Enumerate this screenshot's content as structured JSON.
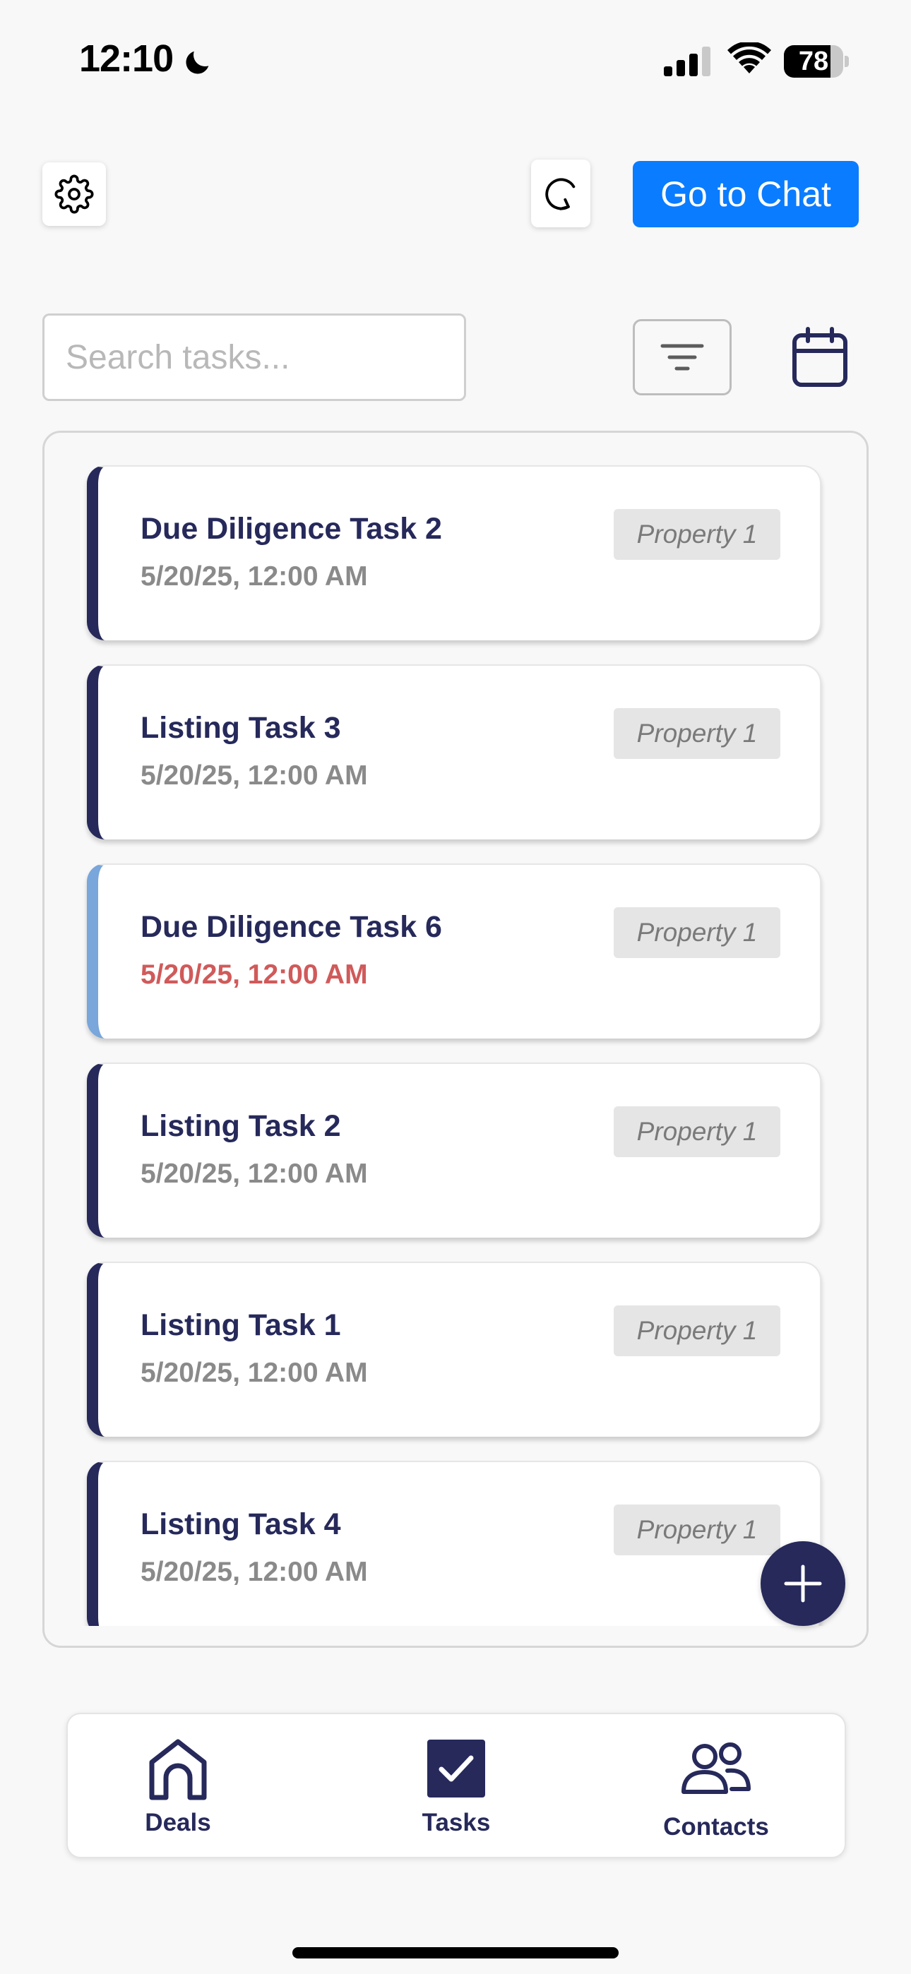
{
  "status_bar": {
    "time": "12:10",
    "battery": "78",
    "battery_level": 0.78,
    "icons": [
      "moon-icon",
      "signal-icon",
      "wifi-icon",
      "battery-icon"
    ]
  },
  "toolbar": {
    "settings_icon": "gear-icon",
    "refresh_icon": "refresh-icon",
    "chat_label": "Go to Chat"
  },
  "search": {
    "value": "",
    "placeholder": "Search tasks...",
    "filter_icon": "filter-icon",
    "calendar_icon": "calendar-icon"
  },
  "tasks": [
    {
      "title": "Due Diligence Task 2",
      "date": "5/20/25, 12:00 AM",
      "tag": "Property 1"
    },
    {
      "title": "Listing Task 3",
      "date": "5/20/25, 12:00 AM",
      "tag": "Property 1"
    },
    {
      "title": "Due Diligence Task 6",
      "date": "5/20/25, 12:00 AM",
      "tag": "Property 1"
    },
    {
      "title": "Listing Task 2",
      "date": "5/20/25, 12:00 AM",
      "tag": "Property 1"
    },
    {
      "title": "Listing Task 1",
      "date": "5/20/25, 12:00 AM",
      "tag": "Property 1"
    },
    {
      "title": "Listing Task 4",
      "date": "5/20/25, 12:00 AM",
      "tag": "Property 1"
    }
  ],
  "fab": {
    "icon": "plus-icon"
  },
  "nav": {
    "deals": {
      "label": "Deals",
      "icon": "home-icon"
    },
    "tasks": {
      "label": "Tasks",
      "icon": "checkbox-icon"
    },
    "contacts": {
      "label": "Contacts",
      "icon": "users-icon"
    }
  },
  "colors": {
    "primary": "#26295a",
    "accent_blue": "#0a7cff",
    "accent_light": "#79a6db",
    "overdue": "#d05a5a",
    "muted_text": "#8a8a8a",
    "tag_bg": "#e5e5e5",
    "background": "#f8f8f8"
  }
}
